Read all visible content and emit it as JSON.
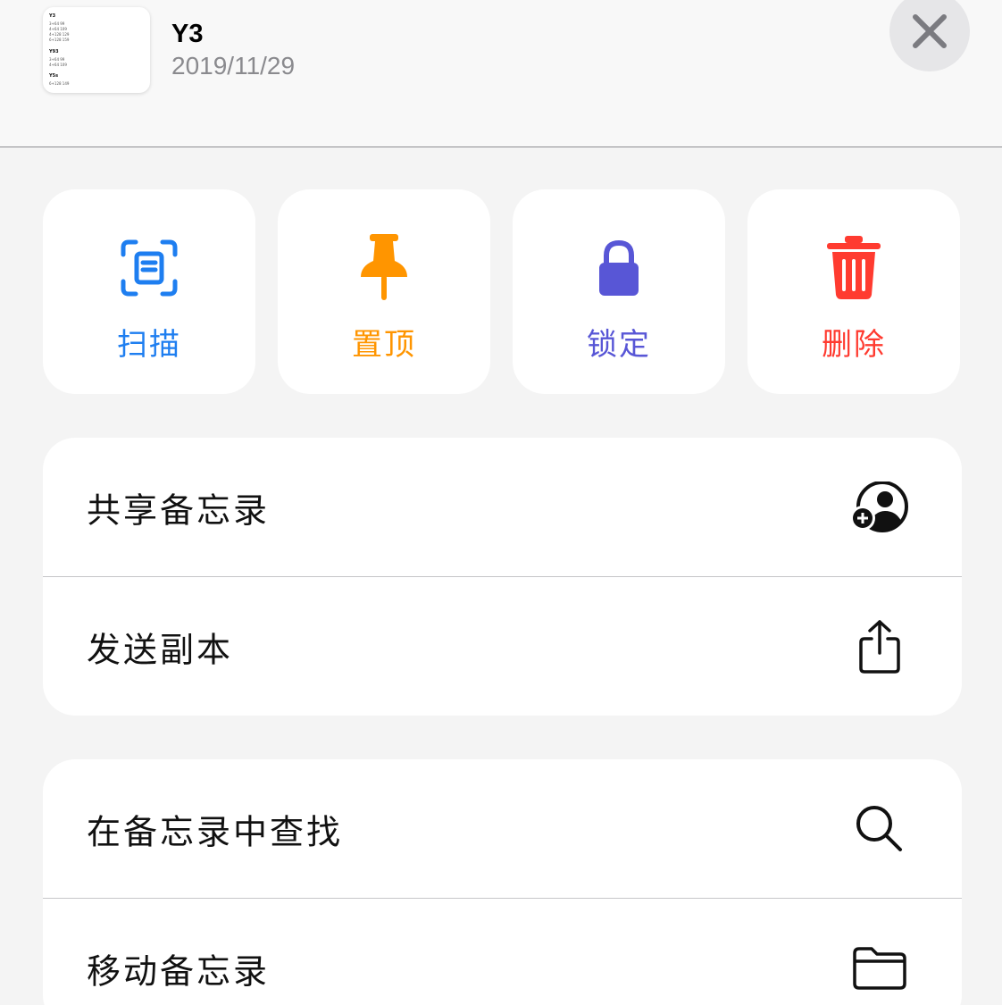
{
  "note": {
    "title": "Y3",
    "date": "2019/11/29",
    "thumbnail_lines": [
      "Y3",
      "3+64  99",
      "4+64 109",
      "4+128 129",
      "6+128 159",
      "Y93",
      "3+64 99",
      "4+64 109",
      "Y5s",
      "6+128 149"
    ]
  },
  "close_button": {
    "icon": "close-icon"
  },
  "actions": [
    {
      "label": "扫描",
      "icon": "scan-document-icon",
      "color": "#1e7ef0"
    },
    {
      "label": "置顶",
      "icon": "pin-icon",
      "color": "#ff9500"
    },
    {
      "label": "锁定",
      "icon": "lock-icon",
      "color": "#5856d6"
    },
    {
      "label": "删除",
      "icon": "trash-icon",
      "color": "#ff3b30"
    }
  ],
  "menu_groups": [
    {
      "rows": [
        {
          "label": "共享备忘录",
          "icon": "share-person-add-icon"
        },
        {
          "label": "发送副本",
          "icon": "share-upload-icon"
        }
      ]
    },
    {
      "rows": [
        {
          "label": "在备忘录中查找",
          "icon": "search-icon"
        },
        {
          "label": "移动备忘录",
          "icon": "folder-icon"
        }
      ]
    }
  ]
}
